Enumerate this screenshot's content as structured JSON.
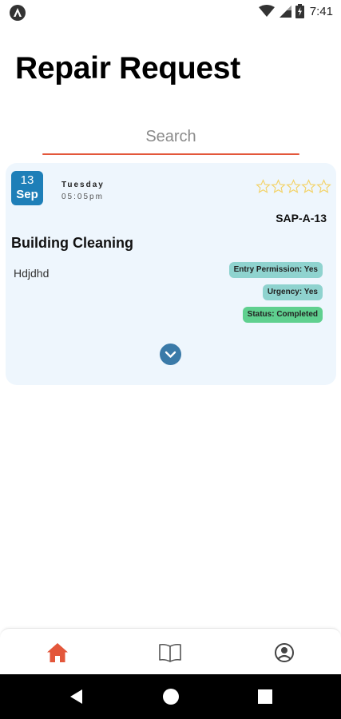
{
  "status_bar": {
    "time": "7:41",
    "icons": [
      "app-notification-icon",
      "wifi-icon",
      "signal-icon",
      "battery-charging-icon"
    ]
  },
  "page": {
    "title": "Repair Request"
  },
  "search": {
    "placeholder": "Search",
    "value": ""
  },
  "request_card": {
    "date_day": "13",
    "date_month": "Sep",
    "weekday": "Tuesday",
    "time": "05:05pm",
    "rating": 0,
    "rating_max": 5,
    "reference": "SAP-A-13",
    "title": "Building Cleaning",
    "description": "Hdjdhd",
    "tags": {
      "entry_permission": "Entry Permission: Yes",
      "urgency": "Urgency: Yes",
      "status": "Status: Completed"
    },
    "expand_icon": "chevron-down-icon"
  },
  "bottom_nav": {
    "items": [
      {
        "icon": "home-icon",
        "active": true
      },
      {
        "icon": "book-icon",
        "active": false
      },
      {
        "icon": "profile-icon",
        "active": false
      }
    ]
  },
  "android_nav": {
    "buttons": [
      "back-icon",
      "home-circle-icon",
      "recents-icon"
    ]
  },
  "colors": {
    "accent": "#e3573b",
    "card_bg": "#eef6fd",
    "date_badge": "#1e7fb8",
    "tag_teal": "#8fd3cf",
    "tag_green": "#5fd08f",
    "star": "#f3d36a"
  }
}
